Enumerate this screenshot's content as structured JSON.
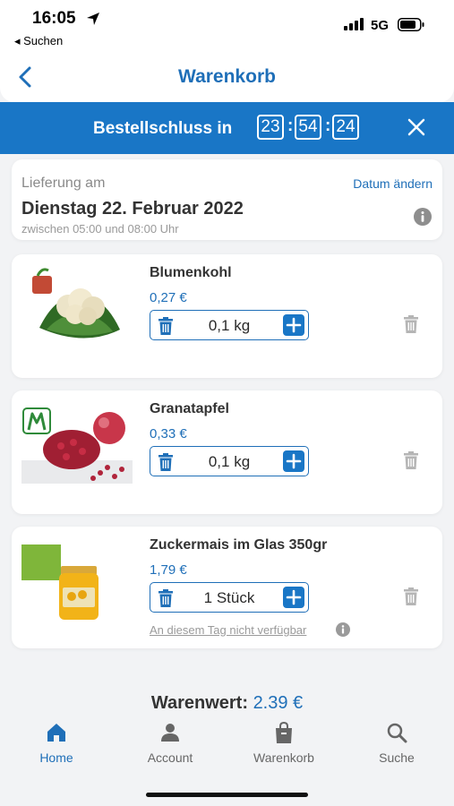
{
  "status_bar": {
    "time": "16:05",
    "back_label": "◂ Suchen",
    "network": "5G"
  },
  "nav": {
    "title": "Warenkorb"
  },
  "deadline": {
    "label": "Bestellschluss in",
    "hours": "23",
    "minutes": "54",
    "seconds": "24"
  },
  "delivery": {
    "label": "Lieferung am",
    "change_label": "Datum ändern",
    "date": "Dienstag 22. Februar 2022",
    "time_window": "zwischen 05:00 und 08:00 Uhr"
  },
  "items": [
    {
      "name": "Blumenkohl",
      "price": "0,27 €",
      "quantity": "0,1 kg"
    },
    {
      "name": "Granatapfel",
      "price": "0,33 €",
      "quantity": "0,1 kg"
    },
    {
      "name": "Zuckermais im Glas 350gr",
      "price": "1,79 €",
      "quantity": "1 Stück",
      "note": "An diesem Tag nicht verfügbar"
    }
  ],
  "summary": {
    "label": "Warenwert:",
    "value": "2.39 €"
  },
  "tabs": [
    {
      "label": "Home",
      "icon": "home-icon",
      "active": true
    },
    {
      "label": "Account",
      "icon": "person-icon",
      "active": false
    },
    {
      "label": "Warenkorb",
      "icon": "shopping-bag-icon",
      "active": false
    },
    {
      "label": "Suche",
      "icon": "search-icon",
      "active": false
    }
  ],
  "colors": {
    "accent": "#1976c6",
    "text_blue": "#1f6fb8",
    "background": "#f2f3f5"
  }
}
